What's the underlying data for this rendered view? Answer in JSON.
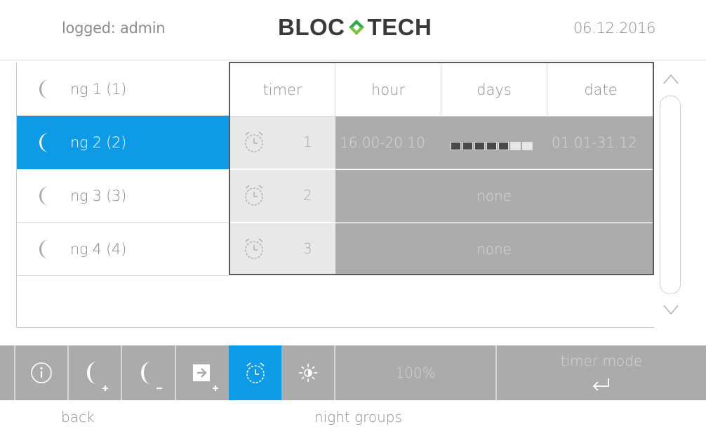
{
  "header": {
    "user": "logged: admin",
    "brand_left": "BLOC",
    "brand_right": "TECH",
    "date": "06.12.2016",
    "brand_colors": {
      "text": "#3a3a3a",
      "mark_top": "#2fa84f",
      "mark_bottom": "#7cc242"
    }
  },
  "night_groups": [
    {
      "label": "ng 1 (1)",
      "icon": "moon-icon",
      "selected": false
    },
    {
      "label": "ng 2 (2)",
      "icon": "moon-icon",
      "selected": true
    },
    {
      "label": "ng 3 (3)",
      "icon": "moon-icon",
      "selected": false
    },
    {
      "label": "ng 4 (4)",
      "icon": "moon-icon",
      "selected": false
    }
  ],
  "timers_table": {
    "columns": [
      "timer",
      "hour",
      "days",
      "date"
    ],
    "rows": [
      {
        "number": "1",
        "icon": "alarm-clock-icon",
        "hour": "16.00-20.10",
        "days": [
          true,
          true,
          true,
          true,
          true,
          false,
          false
        ],
        "date": "01.01-31.12",
        "none": ""
      },
      {
        "number": "2",
        "icon": "alarm-clock-icon",
        "hour": "",
        "days": [],
        "date": "",
        "none": "none"
      },
      {
        "number": "3",
        "icon": "alarm-clock-icon",
        "hour": "",
        "days": [],
        "date": "",
        "none": "none"
      }
    ]
  },
  "toolbar": {
    "buttons": [
      "info-icon",
      "add-night-group-icon",
      "remove-night-group-icon",
      "add-assignment-icon",
      "timer-icon",
      "brightness-icon"
    ],
    "active": "timer-icon",
    "brightness": "100%",
    "mode_label": "timer mode",
    "mode_icon": "enter-icon"
  },
  "footer": {
    "back_label": "back",
    "screen_label": "night groups"
  },
  "colors": {
    "accent": "#0d9be8",
    "toolbar_bg": "#ababab",
    "row_bg": "#acacac",
    "timer_cell_bg": "#e8e8e8"
  }
}
